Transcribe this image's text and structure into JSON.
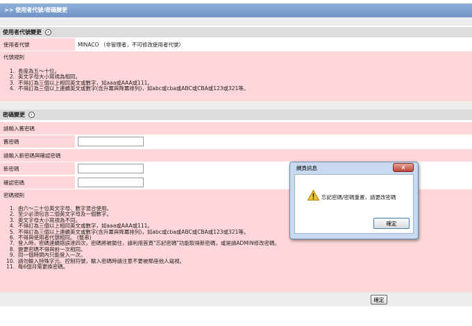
{
  "page": {
    "title": ">> 使用者代號/密碼變更"
  },
  "userid_section": {
    "heading": "使用者代號變更",
    "field_label": "使用者代號",
    "field_value": "MINACO （非管理者，不可修改使用者代號）",
    "rules_title": "代號規則",
    "rules": [
      {
        "n": "1.",
        "text": "長度為五～十位。"
      },
      {
        "n": "2.",
        "text": "英文字母大小寫視為相同。"
      },
      {
        "n": "3.",
        "text": "不得訂為三個以上相同英文或數字，如aaa或AAA或111。"
      },
      {
        "n": "4.",
        "text": "不得訂為三個以上連續英文或數字(含升冪與降冪排列)，如abc或cba或ABC或CBA或123或321等。"
      }
    ]
  },
  "password_section": {
    "heading": "密碼變更",
    "old_prompt": "請輸入舊密碼",
    "old_label": "舊密碼",
    "new_prompt": "請輸入新密碼與確認密碼",
    "new_label": "新密碼",
    "confirm_label": "確認密碼",
    "rules_title": "密碼規則",
    "rules": [
      {
        "n": "1.",
        "text": "由六～二十位英文字母、數字混合使用。"
      },
      {
        "n": "2.",
        "text": "至少必須包含二個英文字母及一個數字。"
      },
      {
        "n": "3.",
        "text": "英文字母大小寫視為不同。"
      },
      {
        "n": "4.",
        "text": "不得訂為三個以上相同英文或數字，如aaa或AAA或111。"
      },
      {
        "n": "5.",
        "text": "不得訂為三個以上連續英文或數字(含升冪與降冪排列)，如abc或cba或ABC或CBA或123或321等。"
      },
      {
        "n": "6.",
        "text": "不得與使用者代號相同。 (整串)"
      },
      {
        "n": "7.",
        "text": "登入時，密碼連續錯誤達四次，密碼將被鎖住，請利用首頁\"忘記密碼\"功能取得新密碼，或是請ADMIN修改密碼。"
      },
      {
        "n": "8.",
        "text": "變更密碼不得與前一次相同。"
      },
      {
        "n": "9.",
        "text": "同一個時間內只能登入一次。"
      },
      {
        "n": "10.",
        "text": "請勿輸入特殊字元、控制符號，輸入密碼時請注意不要被鄰座他人窺視。"
      },
      {
        "n": "11.",
        "text": "每6個月需更換密碼。"
      }
    ],
    "confirm_button": "確定"
  },
  "dialog": {
    "title": "網頁訊息",
    "close_glyph": "×",
    "message": "忘記密碼/密碼重置，請更改密碼",
    "ok_button": "確定"
  }
}
